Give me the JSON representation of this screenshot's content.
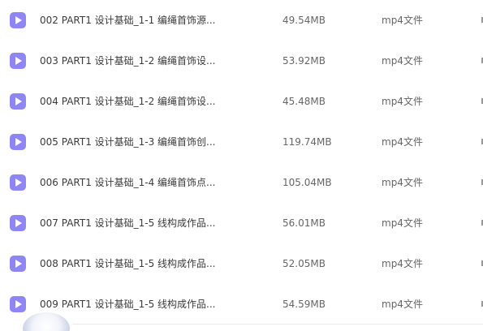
{
  "files": [
    {
      "name": "002 PART1 设计基础_1-1 编绳首饰源...",
      "size": "49.54MB",
      "type": "mp4文件",
      "icon": "video-file-icon"
    },
    {
      "name": "003 PART1 设计基础_1-2 编绳首饰设...",
      "size": "53.92MB",
      "type": "mp4文件",
      "icon": "video-file-icon"
    },
    {
      "name": "004 PART1 设计基础_1-2 编绳首饰设...",
      "size": "45.48MB",
      "type": "mp4文件",
      "icon": "video-file-icon"
    },
    {
      "name": "005 PART1 设计基础_1-3 编绳首饰创...",
      "size": "119.74MB",
      "type": "mp4文件",
      "icon": "video-file-icon"
    },
    {
      "name": "006 PART1 设计基础_1-4 编绳首饰点...",
      "size": "105.04MB",
      "type": "mp4文件",
      "icon": "video-file-icon"
    },
    {
      "name": "007 PART1 设计基础_1-5 线构成作品...",
      "size": "56.01MB",
      "type": "mp4文件",
      "icon": "video-file-icon"
    },
    {
      "name": "008 PART1 设计基础_1-5 线构成作品...",
      "size": "52.05MB",
      "type": "mp4文件",
      "icon": "video-file-icon"
    },
    {
      "name": "009 PART1 设计基础_1-5 线构成作品...",
      "size": "54.59MB",
      "type": "mp4文件",
      "icon": "video-file-icon"
    }
  ],
  "colors": {
    "icon_accent": "#8f86f6",
    "text_primary": "#3b3b3b",
    "text_secondary": "#666666"
  }
}
